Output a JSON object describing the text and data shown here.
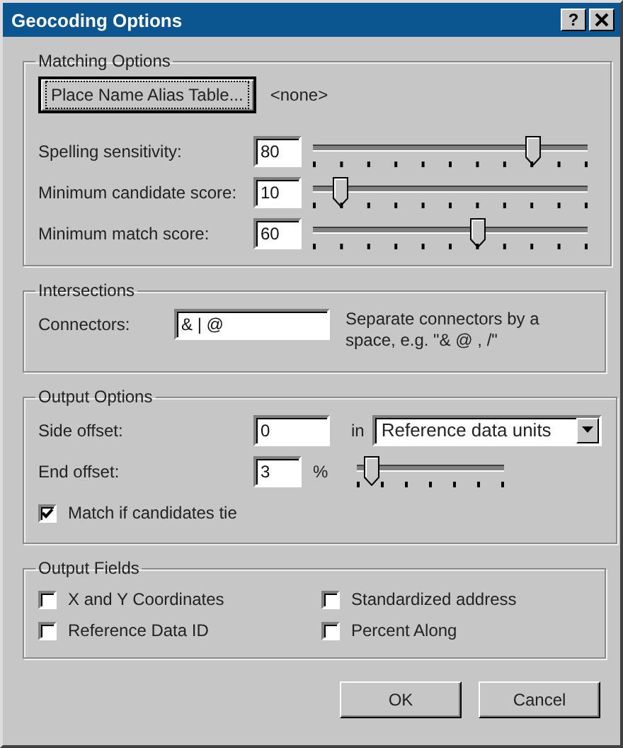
{
  "window": {
    "title": "Geocoding Options",
    "help_button": "?"
  },
  "matching_options": {
    "title": "Matching Options",
    "alias_button": "Place Name Alias Table...",
    "alias_value": "<none>",
    "sliders": [
      {
        "label": "Spelling sensitivity:",
        "value": "80",
        "level": 0.8
      },
      {
        "label": "Minimum candidate score:",
        "value": "10",
        "level": 0.1
      },
      {
        "label": "Minimum match score:",
        "value": "60",
        "level": 0.6
      }
    ]
  },
  "intersections": {
    "title": "Intersections",
    "connectors_label": "Connectors:",
    "connectors_value": "& | @",
    "hint": "Separate connectors by a space, e.g. \"& @ , /\""
  },
  "output_options": {
    "title": "Output Options",
    "side_offset_label": "Side offset:",
    "side_offset_value": "0",
    "units_prefix": "in",
    "units_value": "Reference data units",
    "end_offset_label": "End offset:",
    "end_offset_value": "3",
    "end_offset_unit": "%",
    "end_slider": {
      "level": 0.1
    },
    "tie_checkbox": {
      "label": "Match if candidates tie",
      "checked": true
    }
  },
  "output_fields": {
    "title": "Output Fields",
    "checkboxes": [
      {
        "label": "X and Y Coordinates",
        "checked": false
      },
      {
        "label": "Standardized address",
        "checked": false
      },
      {
        "label": "Reference Data ID",
        "checked": false
      },
      {
        "label": "Percent Along",
        "checked": false
      }
    ]
  },
  "buttons": [
    {
      "label": "OK"
    },
    {
      "label": "Cancel"
    }
  ]
}
